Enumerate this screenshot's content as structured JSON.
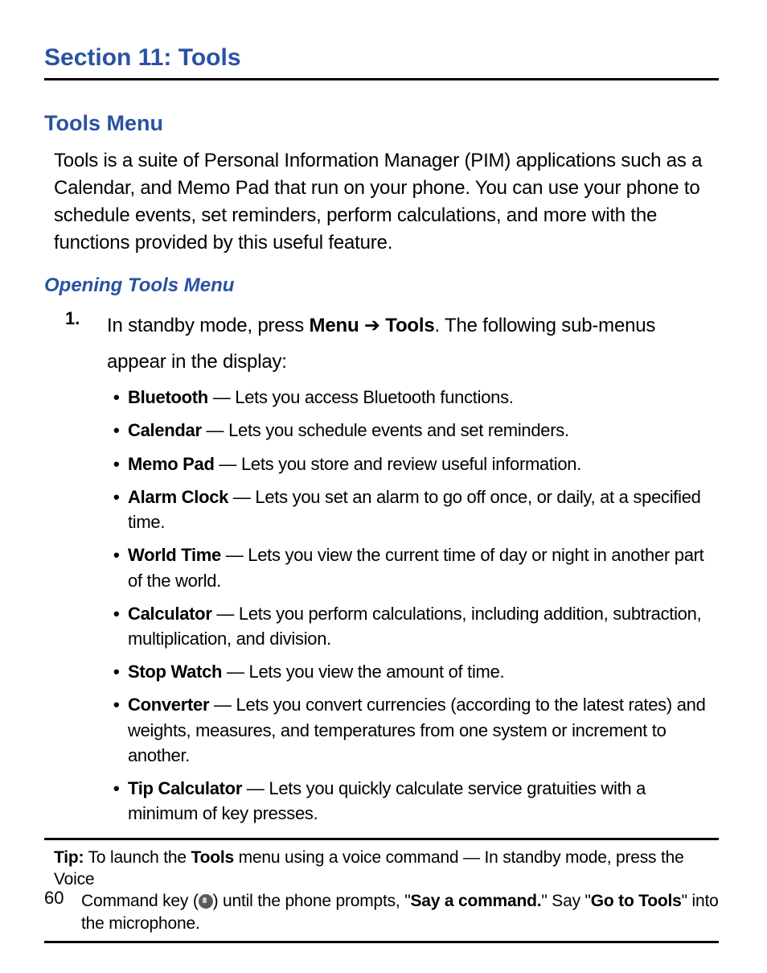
{
  "section_title": "Section 11: Tools",
  "heading1": "Tools Menu",
  "intro": "Tools is a suite of Personal Information Manager (PIM) applications such as a Calendar, and Memo Pad that run on your phone. You can use your phone to schedule events, set reminders, perform calculations, and more with the functions provided by this useful feature.",
  "heading2": "Opening Tools Menu",
  "step": {
    "num": "1.",
    "pre": "In standby mode, press ",
    "menu": "Menu",
    "arrow": " ➔ ",
    "tools": "Tools",
    "post": ". The following sub-menus appear in the display:"
  },
  "bullets": [
    {
      "name": "Bluetooth",
      "desc": " — Lets you access Bluetooth functions."
    },
    {
      "name": "Calendar",
      "desc": " — Lets you schedule events and set reminders."
    },
    {
      "name": "Memo Pad",
      "desc": " — Lets you store and review useful information."
    },
    {
      "name": "Alarm Clock",
      "desc": " — Lets you set an alarm to go off once, or daily, at a specified time."
    },
    {
      "name": "World Time",
      "desc": " — Lets you view the current time of day or night in another part of the world."
    },
    {
      "name": "Calculator",
      "desc": " — Lets you perform calculations, including addition, subtraction, multiplication, and division."
    },
    {
      "name": "Stop Watch",
      "desc": " — Lets you view the amount of time."
    },
    {
      "name": "Converter",
      "desc": " — Lets you convert currencies (according to the latest rates) and weights, measures, and temperatures from one system or increment to another."
    },
    {
      "name": "Tip Calculator",
      "desc": " — Lets you quickly calculate service gratuities with a minimum of key presses."
    }
  ],
  "tip": {
    "label": "Tip:",
    "pre": " To launch the ",
    "tools": "Tools",
    "mid1": " menu using a voice command — In standby mode, press the Voice ",
    "line2a": "Command key (",
    "line2b": ") until the phone prompts, \"",
    "say": "Say a command.",
    "mid2": "\" Say \"",
    "goto": "Go to Tools",
    "post": "\" into the microphone."
  },
  "page_number": "60"
}
